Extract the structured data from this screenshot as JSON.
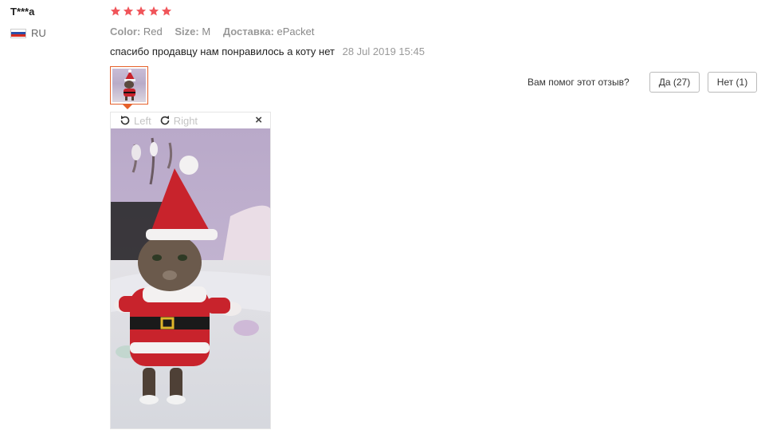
{
  "reviewer": {
    "name": "T***a",
    "country": "RU"
  },
  "rating": {
    "stars": 5,
    "star_color": "#f0555a"
  },
  "attributes": {
    "color_label": "Color:",
    "color_value": "Red",
    "size_label": "Size:",
    "size_value": "M",
    "shipping_label": "Доставка:",
    "shipping_value": "ePacket"
  },
  "review": {
    "text": "спасибо продавцу нам понравилось а коту нет",
    "date": "28 Jul 2019 15:45"
  },
  "helpful": {
    "question": "Вам помог этот отзыв?",
    "yes_label": "Да (27)",
    "no_label": "Нет (1)"
  },
  "viewer": {
    "rotate_left_label": "Left",
    "rotate_right_label": "Right",
    "close_label": "×"
  },
  "colors": {
    "accent": "#e5602a",
    "text_muted": "#999999"
  }
}
